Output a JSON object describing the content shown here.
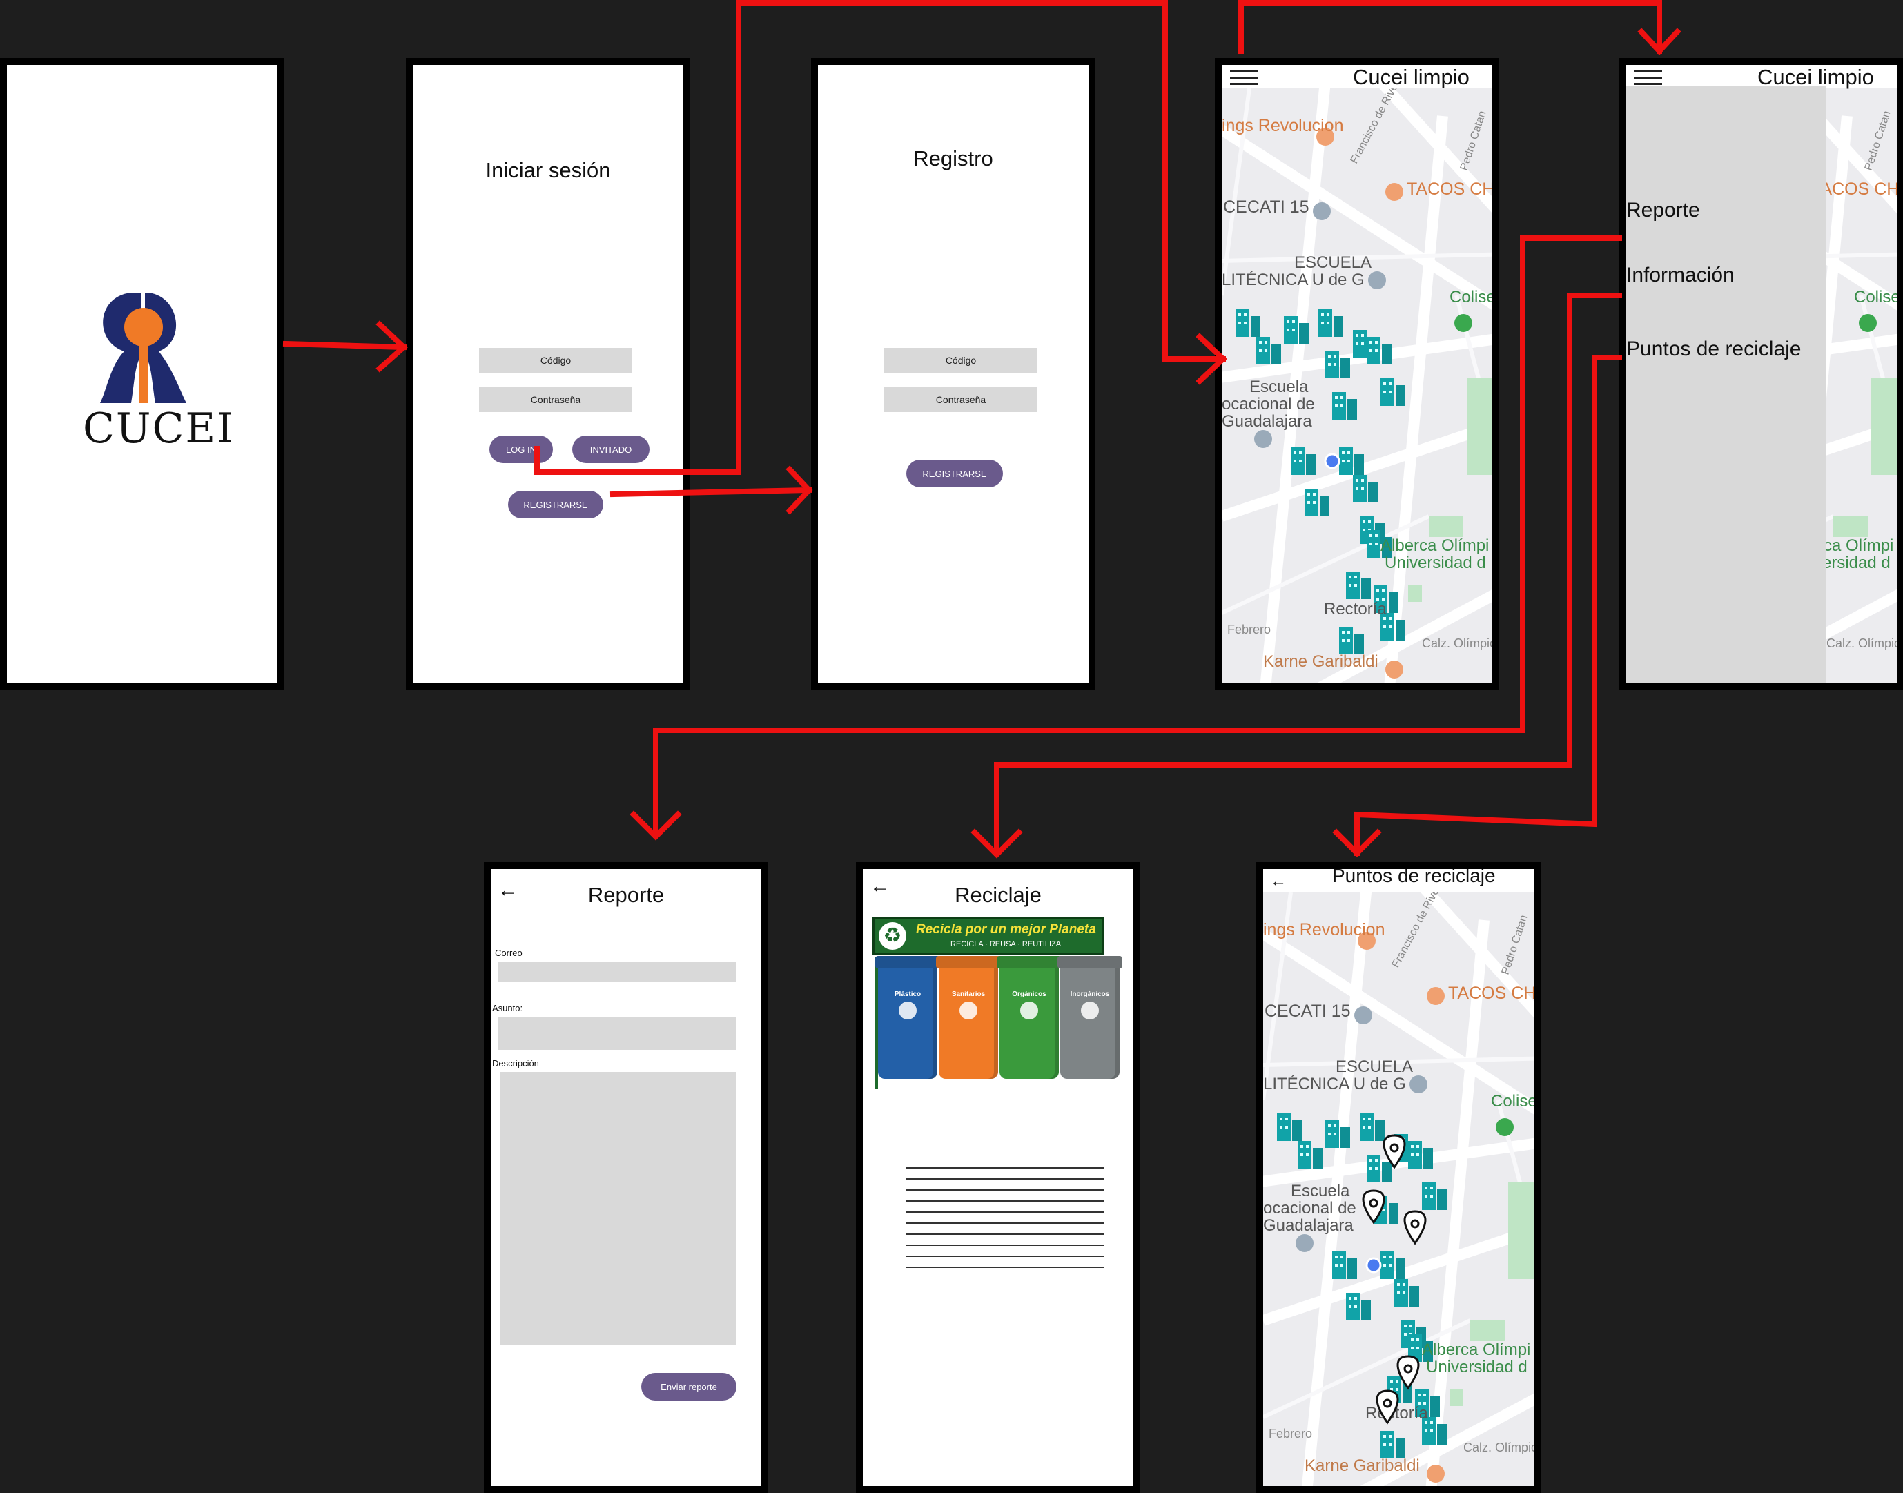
{
  "splash": {
    "logo_text": "CUCEI"
  },
  "login": {
    "title": "Iniciar sesión",
    "code_field": "Código",
    "password_field": "Contraseña",
    "login_button": "LOG IN",
    "guest_button": "INVITADO",
    "register_button": "REGISTRARSE"
  },
  "register": {
    "title": "Registro",
    "code_field": "Código",
    "password_field": "Contraseña",
    "register_button": "REGISTRARSE"
  },
  "map_screen": {
    "title": "Cucei limpio",
    "map_labels": [
      "ings Revolucion",
      "TACOS CH",
      "CECATI 15",
      "ESCUELA",
      "LITÉCNICA U de G",
      "Colise",
      "Escuela",
      "ocacional de",
      "Guadalajara",
      "Alberca Olímpi",
      "Universidad d",
      "Rectoría",
      "Febrero",
      "Calz. Olímpica",
      "Karne Garibaldi",
      "Francisco de Rive",
      "Pedro Catan"
    ]
  },
  "menu_screen": {
    "title": "Cucei limpio",
    "items": [
      "Reporte",
      "Información",
      "Puntos de reciclaje"
    ]
  },
  "report": {
    "title": "Reporte",
    "email_label": "Correo",
    "subject_label": "Asunto:",
    "description_label": "Descripción",
    "send_button": "Enviar reporte"
  },
  "recycle": {
    "title": "Reciclaje",
    "banner": "Recicla por un mejor Planeta",
    "banner_sub": "RECICLA · REUSA · REUTILIZA",
    "bins": [
      {
        "label": "Plástico",
        "color": "#2360a8"
      },
      {
        "label": "Sanitarios",
        "color": "#f07a26"
      },
      {
        "label": "Orgánicos",
        "color": "#3a9a3c"
      },
      {
        "label": "Inorgánicos",
        "color": "#7e8486"
      }
    ]
  },
  "points_screen": {
    "title": "Puntos de reciclaje"
  },
  "colors": {
    "arrow": "#ee1111",
    "button": "#6a5a8c",
    "field": "#d9d9d9",
    "background": "#1e1e1e"
  }
}
